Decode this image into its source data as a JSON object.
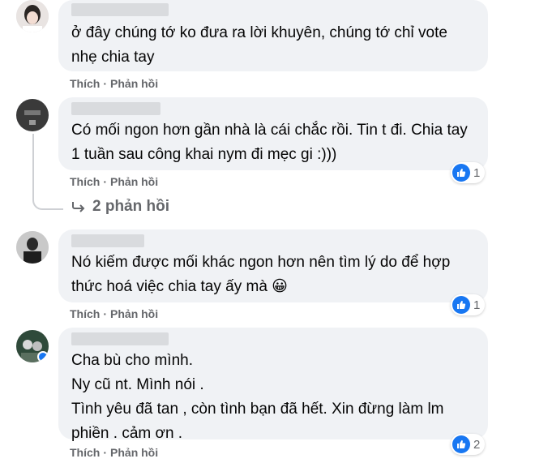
{
  "comments": [
    {
      "text": "ở đây chúng tớ ko đưa ra lời khuyên, chúng tớ chỉ vote nhẹ chia tay",
      "like_label": "Thích",
      "reply_label": "Phản hồi"
    },
    {
      "text": "Có mối ngon hơn gần nhà là cái chắc rồi. Tin t đi. Chia tay 1 tuần sau công khai nym đi mẹc gi :)))",
      "like_label": "Thích",
      "reply_label": "Phản hồi",
      "reaction_count": "1",
      "view_replies": "2 phản hồi"
    },
    {
      "text": "Nó kiếm được mối khác ngon hơn nên tìm lý do để hợp thức hoá việc chia tay ấy mà 😀",
      "like_label": "Thích",
      "reply_label": "Phản hồi",
      "reaction_count": "1"
    },
    {
      "lines": [
        "Cha bù cho mình.",
        "Ny cũ nt. Mình nói .",
        "Tình yêu đã tan , còn tình bạn đã hết. Xin đừng làm lm phiền . cảm ơn ."
      ],
      "like_label": "Thích",
      "reply_label": "Phản hồi",
      "reaction_count": "2"
    }
  ],
  "colors": {
    "bubble": "#f0f2f5",
    "action_text": "#65676b",
    "like_blue": "#1877f2"
  },
  "icons": [
    "like-icon",
    "reply-arrow-icon",
    "avatar"
  ]
}
